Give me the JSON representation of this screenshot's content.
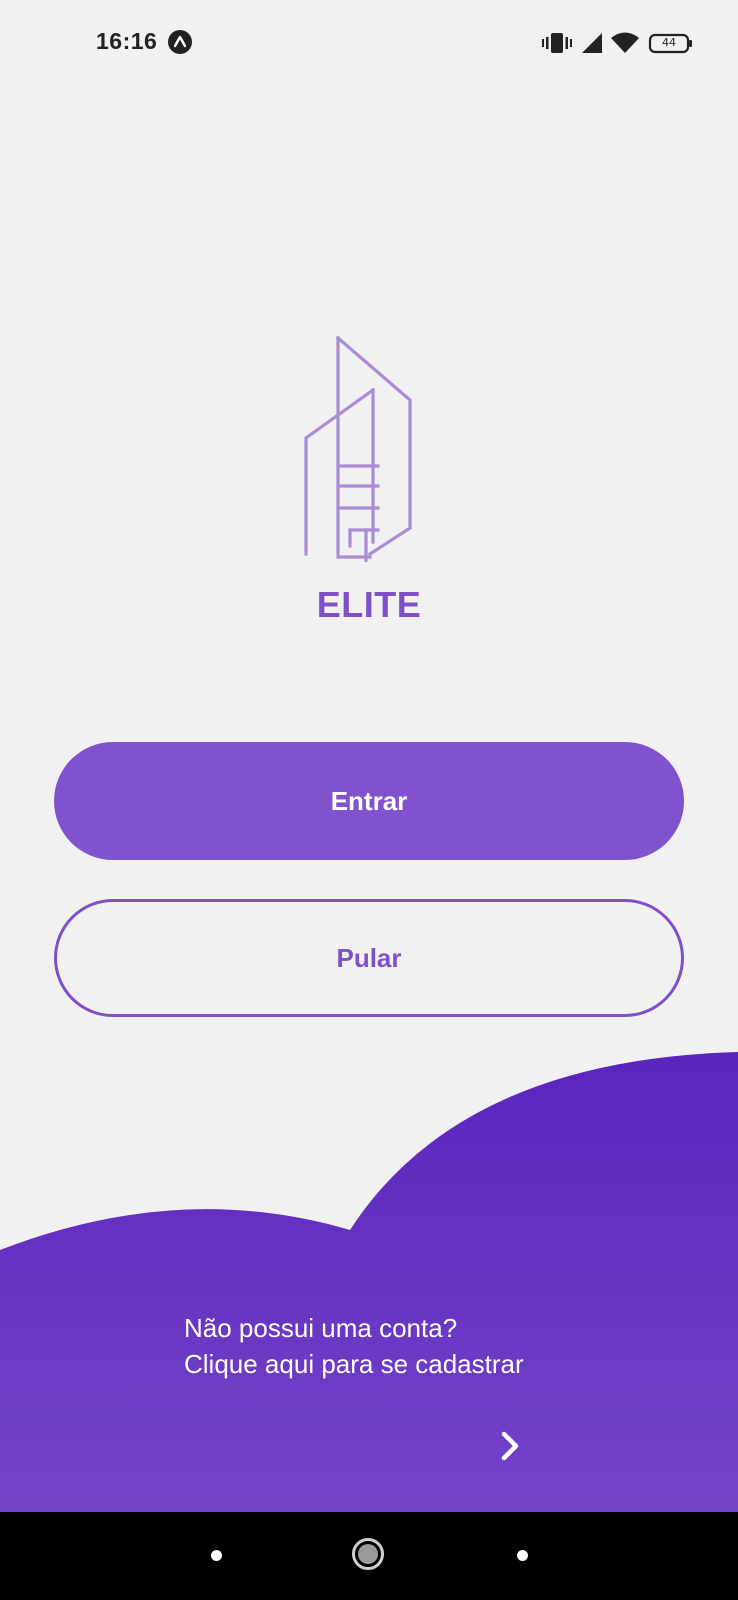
{
  "status_bar": {
    "time": "16:16",
    "app_icon": "arrow-up-circle-icon",
    "icons": [
      "vibrate-icon",
      "cell-signal-icon",
      "wifi-icon",
      "battery-icon"
    ],
    "battery_level": "44"
  },
  "brand": {
    "logo_icon": "building-outline-icon",
    "title": "ELITE",
    "color": "#7f50c9"
  },
  "actions": {
    "login_label": "Entrar",
    "skip_label": "Pular"
  },
  "signup": {
    "line1": "Não possui uma conta?",
    "line2": "Clique aqui para se cadastrar",
    "arrow_icon": "chevron-right-icon"
  },
  "navigation": {
    "back_icon": "nav-dot-icon",
    "home_icon": "nav-home-icon",
    "recents_icon": "nav-dot-icon"
  },
  "colors": {
    "background": "#f1f1f1",
    "primary": "#8052cd",
    "wave_top": "#5a24bd",
    "wave_bottom": "#7444c8"
  }
}
